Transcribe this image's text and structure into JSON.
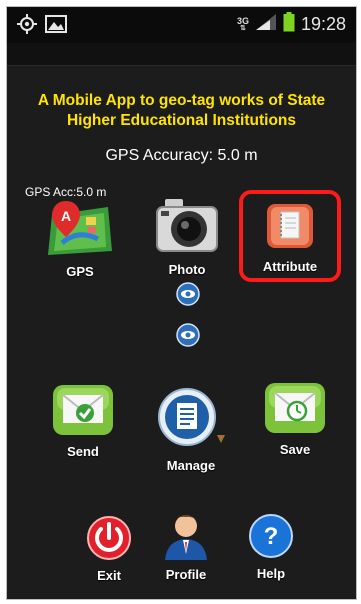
{
  "status_bar": {
    "network": "3G",
    "time": "19:28",
    "icons": [
      "gps-icon",
      "image-icon",
      "signal-icon",
      "battery-icon"
    ]
  },
  "title": {
    "line1": "A Mobile App to geo-tag works of State",
    "line2": "Higher Educational Institutions"
  },
  "gps_accuracy": "GPS Accuracy: 5.0 m",
  "gps_acc_small": "GPS Acc:5.0 m",
  "buttons": {
    "gps": "GPS",
    "photo": "Photo",
    "attribute": "Attribute",
    "send": "Send",
    "manage": "Manage",
    "save": "Save",
    "exit": "Exit",
    "profile": "Profile",
    "help": "Help"
  },
  "colors": {
    "title": "#ffe400",
    "highlight": "#ff1a1a",
    "green_button": "#7cc23a"
  }
}
